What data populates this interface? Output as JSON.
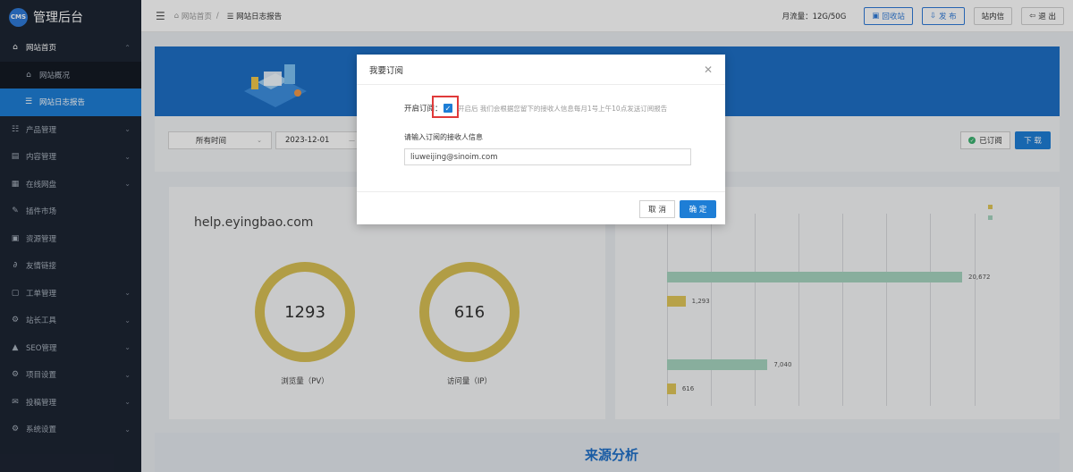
{
  "app": {
    "logo_text": "CMS",
    "title": "管理后台"
  },
  "sidebar": {
    "items": [
      {
        "icon": "home-icon",
        "glyph": "⌂",
        "label": "网站首页",
        "chevron": "⌃",
        "state": "open"
      },
      {
        "icon": "home-icon",
        "glyph": "⌂",
        "label": "网站概况",
        "state": "sub"
      },
      {
        "icon": "list-icon",
        "glyph": "☰",
        "label": "网站日志报告",
        "state": "sub-active"
      },
      {
        "icon": "product-icon",
        "glyph": "☷",
        "label": "产品管理",
        "chevron": "⌄"
      },
      {
        "icon": "content-icon",
        "glyph": "▤",
        "label": "内容管理",
        "chevron": "⌄"
      },
      {
        "icon": "disk-icon",
        "glyph": "▦",
        "label": "在线网盘",
        "chevron": "⌄"
      },
      {
        "icon": "plugin-icon",
        "glyph": "✎",
        "label": "插件市场"
      },
      {
        "icon": "resource-icon",
        "glyph": "▣",
        "label": "资源管理"
      },
      {
        "icon": "link-icon",
        "glyph": "∂",
        "label": "友情链接"
      },
      {
        "icon": "ticket-icon",
        "glyph": "▢",
        "label": "工单管理",
        "chevron": "⌄"
      },
      {
        "icon": "tools-icon",
        "glyph": "⚙",
        "label": "站长工具",
        "chevron": "⌄"
      },
      {
        "icon": "seo-icon",
        "glyph": "▲",
        "label": "SEO管理",
        "chevron": "⌄"
      },
      {
        "icon": "settings-icon",
        "glyph": "⚙",
        "label": "项目设置",
        "chevron": "⌄"
      },
      {
        "icon": "mail-icon",
        "glyph": "✉",
        "label": "投稿管理",
        "chevron": "⌄"
      },
      {
        "icon": "gear-icon",
        "glyph": "⚙",
        "label": "系统设置",
        "chevron": "⌄"
      }
    ]
  },
  "topbar": {
    "fold_glyph": "☰",
    "breadcrumb_home": "网站首页",
    "breadcrumb_sep": "/",
    "breadcrumb_current": "☰ 网站日志报告",
    "traffic": "月流量：12G/50G",
    "recycle_label": "回收站",
    "publish_label": "发 布",
    "site_mail_label": "站内信",
    "logout_label": "退 出"
  },
  "filters": {
    "time_range": "所有时间",
    "date_start": "2023-12-01",
    "date_dash": "—",
    "subscribed_label": "已订阅",
    "download_label": "下 载"
  },
  "stats": {
    "domain": "help.eyingbao.com",
    "pv_value": "1293",
    "pv_label": "浏览量（PV）",
    "ip_value": "616",
    "ip_label": "访问量（IP）"
  },
  "chart_data": {
    "type": "bar",
    "orientation": "horizontal",
    "series": [
      {
        "color": "#a7d5c0",
        "values": [
          20672,
          7040
        ]
      },
      {
        "color": "#e0c65a",
        "values": [
          1293,
          616
        ]
      }
    ],
    "labels": [
      "20,672",
      "1,293",
      "7,040",
      "616"
    ],
    "grid": true
  },
  "section": {
    "title": "来源分析"
  },
  "modal": {
    "title": "我要订阅",
    "close_glyph": "✕",
    "enable_label": "开启订阅：",
    "checkbox_checked": true,
    "hint": "开启后 我们会根据您留下的接收人信息每月1号上午10点发送订阅报告",
    "recipient_label": "请输入订阅的接收人信息",
    "recipient_value": "liuweijing@sinoim.com",
    "cancel_label": "取 消",
    "ok_label": "确 定"
  }
}
